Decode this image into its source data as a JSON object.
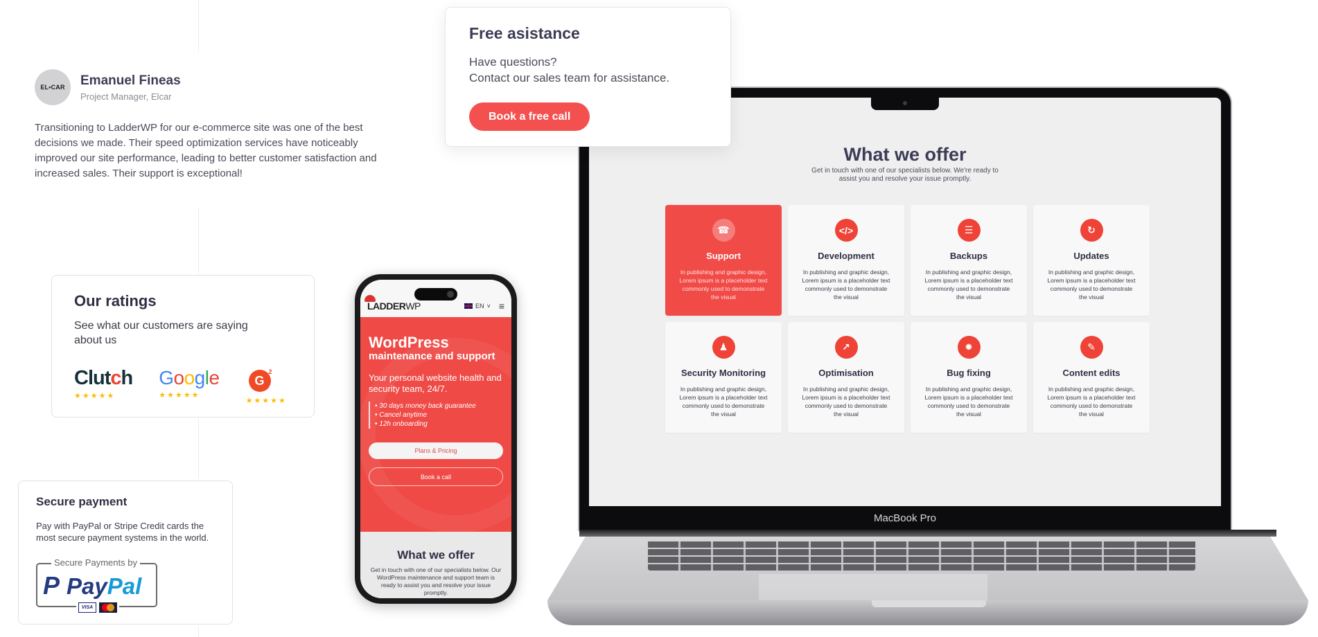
{
  "testimonial": {
    "avatar_text": "EL•CAR",
    "name": "Emanuel Fineas",
    "role": "Project Manager, Elcar",
    "quote": "Transitioning to LadderWP for our e-commerce site was one of the best decisions we made. Their speed optimization services have noticeably improved our site performance, leading to better customer satisfaction and increased sales. Their support is exceptional!"
  },
  "assistance": {
    "title": "Free asistance",
    "line1": "Have questions?",
    "line2": "Contact our sales team for assistance.",
    "button": "Book a free call"
  },
  "ratings": {
    "title": "Our ratings",
    "subtitle": "See what our customers are saying about us",
    "platforms": [
      {
        "name": "Clutch",
        "stars": 5
      },
      {
        "name": "Google",
        "stars": 5
      },
      {
        "name": "G2",
        "stars": 5
      }
    ],
    "star_glyphs": "★★★★★"
  },
  "payment": {
    "title": "Secure payment",
    "text": "Pay with PayPal or Stripe Credit cards the most secure payment systems in the world.",
    "badge_caption": "Secure Payments by",
    "brand_pay": "Pay",
    "brand_pal": "Pal",
    "brand_p": "P",
    "card_visa": "VISA"
  },
  "phone": {
    "logo_main": "LADDER",
    "logo_suffix": "WP",
    "language": "EN",
    "lang_caret": "˅",
    "menu_glyph": "≡",
    "hero_title": "WordPress",
    "hero_subtitle": "maintenance and support",
    "hero_lead": "Your personal website health and security team, 24/7.",
    "features": [
      "• 30 days money back guarantee",
      "• Cancel anytime",
      "• 12h onboarding"
    ],
    "btn_primary": "Plans & Pricing",
    "btn_secondary": "Book a call",
    "offer_title": "What we offer",
    "offer_text": "Get in touch with one of our specialists below. Our WordPress maintenance and support team is ready to assist you and resolve your issue promptly."
  },
  "laptop": {
    "brand": "MacBook Pro",
    "title": "What we offer",
    "subtitle": "Get in touch with one of our specialists below. We're ready to assist you and resolve your issue promptly.",
    "services": [
      {
        "title": "Support",
        "icon": "☎",
        "desc": "In publishing and graphic design, Lorem ipsum is a placeholder text commonly used to demonstrate the visual",
        "active": true
      },
      {
        "title": "Development",
        "icon": "</>",
        "desc": "In publishing and graphic design, Lorem ipsum is a placeholder text commonly used to demonstrate the visual",
        "active": false
      },
      {
        "title": "Backups",
        "icon": "☰",
        "desc": "In publishing and graphic design, Lorem ipsum is a placeholder text commonly used to demonstrate the visual",
        "active": false
      },
      {
        "title": "Updates",
        "icon": "↻",
        "desc": "In publishing and graphic design, Lorem ipsum is a placeholder text commonly used to demonstrate the visual",
        "active": false
      },
      {
        "title": "Security Monitoring",
        "icon": "♟",
        "desc": "In publishing and graphic design, Lorem ipsum is a placeholder text commonly used to demonstrate the visual",
        "active": false
      },
      {
        "title": "Optimisation",
        "icon": "↗",
        "desc": "In publishing and graphic design, Lorem ipsum is a placeholder text commonly used to demonstrate the visual",
        "active": false
      },
      {
        "title": "Bug fixing",
        "icon": "✹",
        "desc": "In publishing and graphic design, Lorem ipsum is a placeholder text commonly used to demonstrate the visual",
        "active": false
      },
      {
        "title": "Content edits",
        "icon": "✎",
        "desc": "In publishing and graphic design, Lorem ipsum is a placeholder text commonly used to demonstrate the visual",
        "active": false
      }
    ]
  },
  "colors": {
    "accent": "#f45050",
    "heading": "#3c3c55",
    "star": "#fbbc05"
  }
}
